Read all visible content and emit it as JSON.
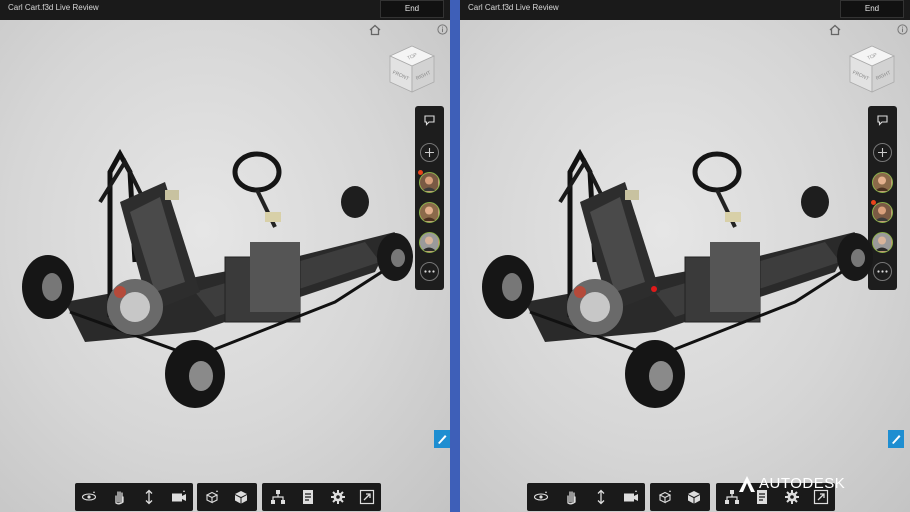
{
  "left_pane": {
    "title": "Carl Cart.f3d Live Review",
    "end_label": "End"
  },
  "right_pane": {
    "title": "Carl Cart.f3d Live Review",
    "end_label": "End"
  },
  "viewcube": {
    "top": "TOP",
    "front": "FRONT",
    "right": "RIGHT"
  },
  "brand": {
    "name": "AUTODESK"
  },
  "colors": {
    "divider": "#3e5fb8",
    "accent_blue": "#1e8ed1",
    "active_presenter": "#e8441b",
    "avatar_ring": "#8ab34a"
  },
  "icons": {
    "top": [
      "home-icon",
      "info-icon"
    ],
    "side_panel": [
      "comment-icon",
      "add-icon",
      "avatar",
      "avatar",
      "avatar",
      "more-icon"
    ],
    "toolbar": [
      "orbit-icon",
      "pan-icon",
      "zoom-icon",
      "camera-icon",
      "explode-icon",
      "model-cube-icon",
      "browser-tree-icon",
      "properties-icon",
      "settings-icon",
      "fullscreen-icon"
    ]
  }
}
